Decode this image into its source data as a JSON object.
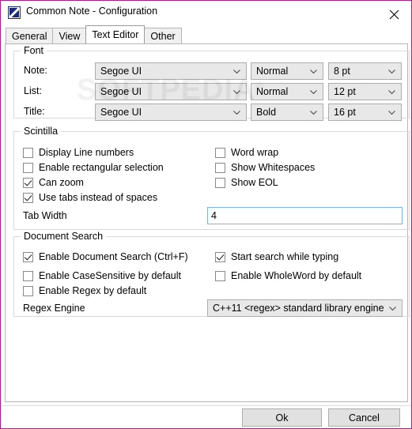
{
  "window": {
    "title": "Common Note - Configuration",
    "icon": "app-note-icon",
    "close_icon": "close-icon",
    "border_color": "#a0248f"
  },
  "tabs": [
    {
      "label": "General",
      "active": false
    },
    {
      "label": "View",
      "active": false
    },
    {
      "label": "Text Editor",
      "active": true
    },
    {
      "label": "Other",
      "active": false
    }
  ],
  "watermark": {
    "text": "SOFTPEDIA",
    "mark": "®"
  },
  "font_group": {
    "title": "Font",
    "rows": [
      {
        "label": "Note:",
        "family": "Segoe UI",
        "style": "Normal",
        "size": "8 pt"
      },
      {
        "label": "List:",
        "family": "Segoe UI",
        "style": "Normal",
        "size": "12 pt"
      },
      {
        "label": "Title:",
        "family": "Segoe UI",
        "style": "Bold",
        "size": "16 pt"
      }
    ]
  },
  "scintilla_group": {
    "title": "Scintilla",
    "left_checkboxes": [
      {
        "label": "Display Line numbers",
        "checked": false
      },
      {
        "label": "Enable rectangular selection",
        "checked": false
      },
      {
        "label": "Can zoom",
        "checked": true
      },
      {
        "label": "Use tabs instead of spaces",
        "checked": true
      }
    ],
    "right_checkboxes": [
      {
        "label": "Word wrap",
        "checked": false
      },
      {
        "label": "Show Whitespaces",
        "checked": false
      },
      {
        "label": "Show EOL",
        "checked": false
      }
    ],
    "tab_width_label": "Tab Width",
    "tab_width_value": "4"
  },
  "search_group": {
    "title": "Document Search",
    "left_checkboxes": [
      {
        "label": "Enable Document Search (Ctrl+F)",
        "checked": true
      },
      {
        "label": "Enable CaseSensitive by default",
        "checked": false
      },
      {
        "label": "Enable Regex by default",
        "checked": false
      }
    ],
    "right_checkboxes": [
      {
        "label": "Start search while typing",
        "checked": true
      },
      {
        "label": "Enable WholeWord by default",
        "checked": false
      }
    ],
    "regex_engine_label": "Regex Engine",
    "regex_engine_value": "C++11 <regex> standard library engine"
  },
  "buttons": {
    "ok": "Ok",
    "cancel": "Cancel"
  }
}
